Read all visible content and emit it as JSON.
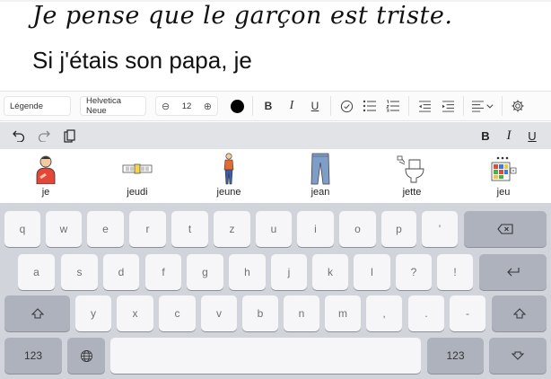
{
  "document": {
    "line1": "Je pense que le garçon est triste.",
    "line2": "Si j'étais son papa, je"
  },
  "format_toolbar": {
    "style": "Légende",
    "font": "Helvetica Neue",
    "size": "12",
    "color": "#000000",
    "bold": "B",
    "italic": "I",
    "underline": "U"
  },
  "edit_bar": {
    "bold": "B",
    "italic": "I",
    "underline": "U"
  },
  "predictions": [
    {
      "word": "je",
      "icon": "person-pointing-self-icon"
    },
    {
      "word": "jeudi",
      "icon": "calendar-strip-icon"
    },
    {
      "word": "jeune",
      "icon": "young-man-icon"
    },
    {
      "word": "jean",
      "icon": "jeans-icon"
    },
    {
      "word": "jette",
      "icon": "throw-in-toilet-icon"
    },
    {
      "word": "jeu",
      "icon": "board-game-icon"
    }
  ],
  "keyboard": {
    "row1": [
      "q",
      "w",
      "e",
      "r",
      "t",
      "z",
      "u",
      "i",
      "o",
      "p",
      "'"
    ],
    "row2": [
      "a",
      "s",
      "d",
      "f",
      "g",
      "h",
      "j",
      "k",
      "l",
      "?",
      "!"
    ],
    "row3": [
      "y",
      "x",
      "c",
      "v",
      "b",
      "n",
      "m",
      ",",
      ".",
      "-"
    ],
    "numbers_left": "123",
    "numbers_right": "123"
  }
}
